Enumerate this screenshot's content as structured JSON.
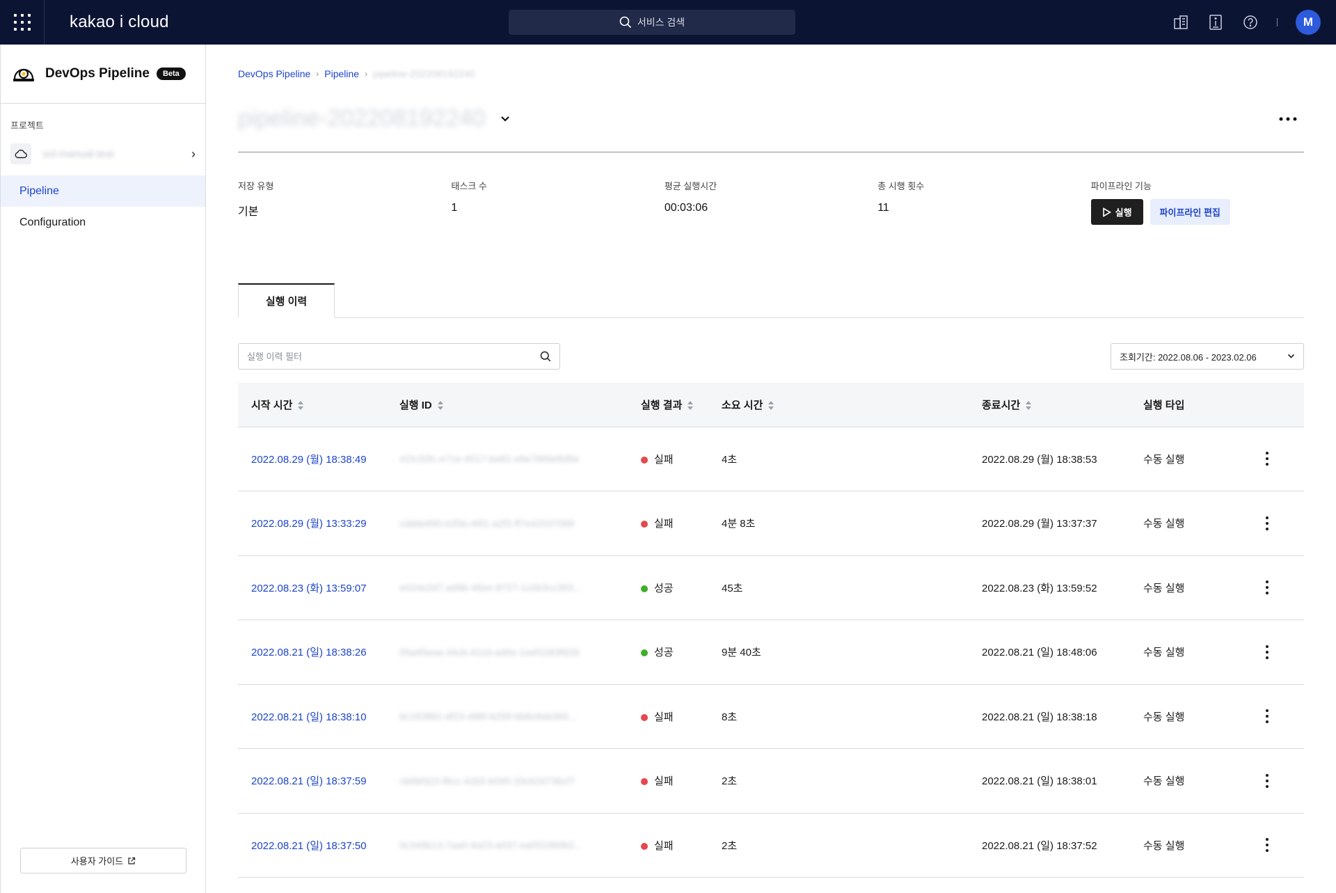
{
  "topbar": {
    "logo": "kakao i cloud",
    "search_placeholder": "서비스 검색",
    "avatar_initial": "M"
  },
  "sidebar": {
    "title": "DevOps Pipeline",
    "badge": "Beta",
    "project_label": "프로젝트",
    "project_name": "sol-manual-test",
    "items": [
      {
        "label": "Pipeline",
        "active": true
      },
      {
        "label": "Configuration",
        "active": false
      }
    ],
    "guide_label": "사용자 가이드"
  },
  "breadcrumb": {
    "items": [
      "DevOps Pipeline",
      "Pipeline"
    ],
    "current": "pipeline-202208192240"
  },
  "page": {
    "title": "pipeline-202208192240"
  },
  "stats": {
    "storage_label": "저장 유형",
    "storage_value": "기본",
    "tasks_label": "태스크 수",
    "tasks_value": "1",
    "avg_label": "평균 실행시간",
    "avg_value": "00:03:06",
    "total_label": "총 시행 횟수",
    "total_value": "11",
    "features_label": "파이프라인 기능",
    "run_label": "실행",
    "edit_label": "파이프라인 편집"
  },
  "tabs": [
    {
      "label": "실행 이력"
    }
  ],
  "filter": {
    "placeholder": "실행 이력 필터",
    "date_range": "조회기간: 2022.08.06 - 2023.02.06"
  },
  "table": {
    "columns": [
      "시작 시간",
      "실행 ID",
      "실행 결과",
      "소요 시간",
      "종료시간",
      "실행 타입"
    ],
    "rows": [
      {
        "start": "2022.08.29 (월) 18:38:49",
        "id": "41fc32fc-e71e-4517-be82-e6e7889e8d5e",
        "result": "실패",
        "status": "fail",
        "duration": "4초",
        "end": "2022.08.29 (월) 18:38:53",
        "type": "수동 실행"
      },
      {
        "start": "2022.08.29 (월) 13:33:29",
        "id": "cddde890-b35b-46f1-a2f2-ff7e42537089",
        "result": "실패",
        "status": "fail",
        "duration": "4분 8초",
        "end": "2022.08.29 (월) 13:37:37",
        "type": "수동 실행"
      },
      {
        "start": "2022.08.23 (화) 13:59:07",
        "id": "e024e2d7-ad9b-48ee-8727-1c0b3cc393...",
        "result": "성공",
        "status": "success",
        "duration": "45초",
        "end": "2022.08.23 (화) 13:59:52",
        "type": "수동 실행"
      },
      {
        "start": "2022.08.21 (일) 18:38:26",
        "id": "05a45eaa-34cb-411d-ad0e-1eef1083f929",
        "result": "성공",
        "status": "success",
        "duration": "9분 40초",
        "end": "2022.08.21 (일) 18:48:06",
        "type": "수동 실행"
      },
      {
        "start": "2022.08.21 (일) 18:38:10",
        "id": "bc183861-df23-486f-b258-bb8c8ab360...",
        "result": "실패",
        "status": "fail",
        "duration": "8초",
        "end": "2022.08.21 (일) 18:38:18",
        "type": "수동 실행"
      },
      {
        "start": "2022.08.21 (일) 18:37:59",
        "id": "cb8bf322-f6cc-42b5-b095-33c624736cf7",
        "result": "실패",
        "status": "fail",
        "duration": "2초",
        "end": "2022.08.21 (일) 18:38:01",
        "type": "수동 실행"
      },
      {
        "start": "2022.08.21 (일) 18:37:50",
        "id": "0c349b13-7aa0-4a23-a037-ea001960b2...",
        "result": "실패",
        "status": "fail",
        "duration": "2초",
        "end": "2022.08.21 (일) 18:37:52",
        "type": "수동 실행"
      }
    ]
  },
  "colors": {
    "topbar_bg": "#0c1433",
    "link": "#1d44c9",
    "fail": "#e5484d",
    "success": "#3fae29"
  }
}
